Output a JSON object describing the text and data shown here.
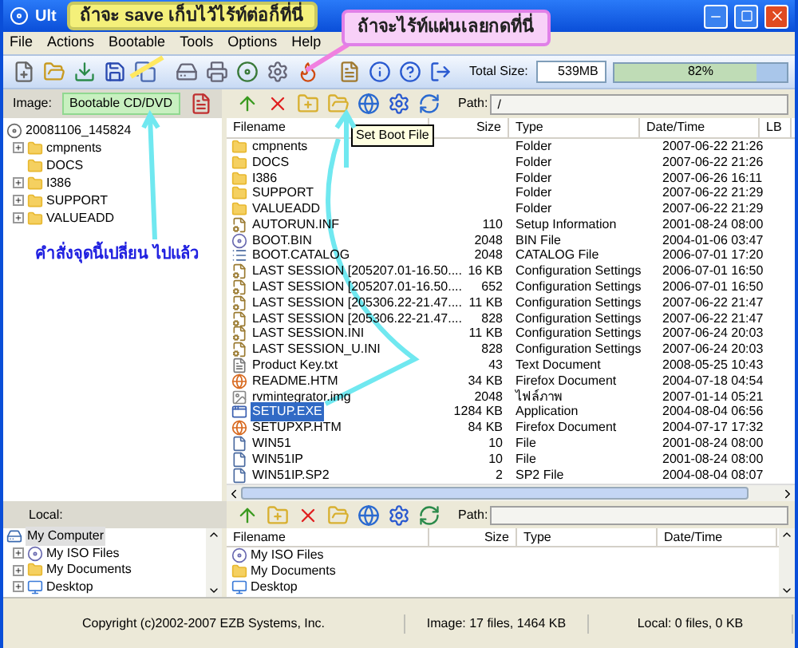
{
  "window": {
    "title": "Ult"
  },
  "callouts": [
    {
      "text": "ถ้าจะ save เก็บไว้ไร้ท์ต่อก็ที่นี่",
      "kind": "yellow"
    },
    {
      "text": "ถ้าจะไร้ท์แผ่นเลยกดที่นี่",
      "kind": "pink"
    },
    {
      "text": "คำสั่งจุดนี้เปลี่ยน ไปแล้ว",
      "kind": "note"
    }
  ],
  "menu": [
    "File",
    "Actions",
    "Bootable",
    "Tools",
    "Options",
    "Help"
  ],
  "toolbar": {
    "total_size_label": "Total Size:",
    "total_size": "539MB",
    "usage": {
      "level": 0.82,
      "reading": "82%"
    }
  },
  "image_bar": {
    "label": "Image:",
    "boot_type": "Bootable CD/DVD"
  },
  "image_tree": {
    "label": "20081106_145824",
    "expanded": true,
    "children": [
      {
        "label": "cmpnents",
        "has_children": true
      },
      {
        "label": "DOCS",
        "has_children": false
      },
      {
        "label": "I386",
        "has_children": true
      },
      {
        "label": "SUPPORT",
        "has_children": true
      },
      {
        "label": "VALUEADD",
        "has_children": true
      }
    ]
  },
  "image_files": {
    "path_label": "Path:",
    "path": "/",
    "tooltip": "Set Boot File",
    "columns": [
      "Filename",
      "Size",
      "Type",
      "Date/Time",
      "LB"
    ],
    "rows": [
      {
        "name": "cmpnents",
        "size": "",
        "type": "Folder",
        "date": "2007-06-22 21:26",
        "kind": "folder",
        "selected": false
      },
      {
        "name": "DOCS",
        "size": "",
        "type": "Folder",
        "date": "2007-06-22 21:26",
        "kind": "folder",
        "selected": false
      },
      {
        "name": "I386",
        "size": "",
        "type": "Folder",
        "date": "2007-06-26 16:11",
        "kind": "folder",
        "selected": false
      },
      {
        "name": "SUPPORT",
        "size": "",
        "type": "Folder",
        "date": "2007-06-22 21:29",
        "kind": "folder",
        "selected": false
      },
      {
        "name": "VALUEADD",
        "size": "",
        "type": "Folder",
        "date": "2007-06-22 21:29",
        "kind": "folder",
        "selected": false
      },
      {
        "name": "AUTORUN.INF",
        "size": "110",
        "type": "Setup Information",
        "date": "2001-08-24 08:00",
        "kind": "config",
        "selected": false
      },
      {
        "name": "BOOT.BIN",
        "size": "2048",
        "type": "BIN File",
        "date": "2004-01-06 03:47",
        "kind": "disc",
        "selected": false
      },
      {
        "name": "BOOT.CATALOG",
        "size": "2048",
        "type": "CATALOG File",
        "date": "2006-07-01 17:20",
        "kind": "catalog",
        "selected": false
      },
      {
        "name": "LAST SESSION [205207.01-16.50....",
        "size": "16 KB",
        "type": "Configuration Settings",
        "date": "2006-07-01 16:50",
        "kind": "config",
        "selected": false
      },
      {
        "name": "LAST SESSION [205207.01-16.50....",
        "size": "652",
        "type": "Configuration Settings",
        "date": "2006-07-01 16:50",
        "kind": "config",
        "selected": false
      },
      {
        "name": "LAST SESSION [205306.22-21.47....",
        "size": "11 KB",
        "type": "Configuration Settings",
        "date": "2007-06-22 21:47",
        "kind": "config",
        "selected": false
      },
      {
        "name": "LAST SESSION [205306.22-21.47....",
        "size": "828",
        "type": "Configuration Settings",
        "date": "2007-06-22 21:47",
        "kind": "config",
        "selected": false
      },
      {
        "name": "LAST SESSION.INI",
        "size": "11 KB",
        "type": "Configuration Settings",
        "date": "2007-06-24 20:03",
        "kind": "config",
        "selected": false
      },
      {
        "name": "LAST SESSION_U.INI",
        "size": "828",
        "type": "Configuration Settings",
        "date": "2007-06-24 20:03",
        "kind": "config",
        "selected": false
      },
      {
        "name": "Product Key.txt",
        "size": "43",
        "type": "Text Document",
        "date": "2008-05-25 10:43",
        "kind": "text",
        "selected": false
      },
      {
        "name": "README.HTM",
        "size": "34 KB",
        "type": "Firefox Document",
        "date": "2004-07-18 04:54",
        "kind": "web",
        "selected": false
      },
      {
        "name": "rvmintegrator.img",
        "size": "2048",
        "type": "ไฟล์ภาพ",
        "date": "2007-01-14 05:21",
        "kind": "image",
        "selected": false
      },
      {
        "name": "SETUP.EXE",
        "size": "1284 KB",
        "type": "Application",
        "date": "2004-08-04 06:56",
        "kind": "app",
        "selected": true
      },
      {
        "name": "SETUPXP.HTM",
        "size": "84 KB",
        "type": "Firefox Document",
        "date": "2004-07-17 17:32",
        "kind": "web",
        "selected": false
      },
      {
        "name": "WIN51",
        "size": "10",
        "type": "File",
        "date": "2001-08-24 08:00",
        "kind": "file",
        "selected": false
      },
      {
        "name": "WIN51IP",
        "size": "10",
        "type": "File",
        "date": "2001-08-24 08:00",
        "kind": "file",
        "selected": false
      },
      {
        "name": "WIN51IP.SP2",
        "size": "2",
        "type": "SP2 File",
        "date": "2004-08-04 08:07",
        "kind": "file",
        "selected": false
      }
    ]
  },
  "local_bar": {
    "label": "Local:",
    "path_label": "Path:"
  },
  "local_tree": {
    "label": "My Computer",
    "selected": true,
    "children": [
      {
        "label": "My ISO Files",
        "kind": "disc"
      },
      {
        "label": "My Documents",
        "kind": "folder"
      },
      {
        "label": "Desktop",
        "kind": "desktop"
      }
    ]
  },
  "local_files": {
    "columns": [
      "Filename",
      "Size",
      "Type",
      "Date/Time"
    ],
    "rows": [
      {
        "name": "My ISO Files",
        "kind": "disc"
      },
      {
        "name": "My Documents",
        "kind": "folder"
      },
      {
        "name": "Desktop",
        "kind": "desktop"
      }
    ]
  },
  "status_bar": [
    "Copyright (c)2002-2007 EZB Systems, Inc.",
    "Image: 17 files, 1464 KB",
    "Local: 0 files, 0 KB"
  ]
}
